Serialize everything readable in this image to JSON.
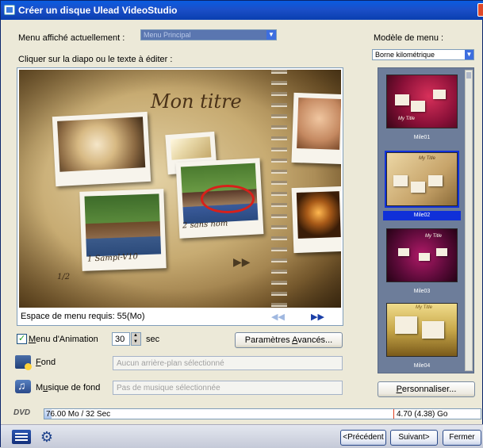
{
  "window": {
    "title": "Créer un disque Ulead VideoStudio"
  },
  "menu_current": {
    "label": "Menu affiché actuellement :",
    "value": "Menu Principal"
  },
  "instruction": "Cliquer sur la diapo ou le texte à éditer :",
  "template_menu": {
    "label": "Modèle de menu :",
    "value": "Borne kilométrique"
  },
  "preview": {
    "title": "Mon titre",
    "caption1": "1 Sampl-V10",
    "caption2": "2 sans nom",
    "page": "1/2",
    "required_space": "Espace de menu requis: 55(Mo)",
    "prev_icon": "double-chevron-left-icon",
    "next_icon": "double-chevron-right-icon"
  },
  "animation": {
    "label_pre": "",
    "label_key": "M",
    "label_post": "enu d'Animation",
    "checked": true,
    "value": "30",
    "unit": "sec"
  },
  "advanced_button": {
    "pre": "Paramètres ",
    "key": "A",
    "post": "vancés..."
  },
  "background": {
    "label_key": "F",
    "label_post": "ond",
    "placeholder": "Aucun arrière-plan sélectionné"
  },
  "music": {
    "label_pre": "M",
    "label_key": "u",
    "label_post": "sique de fond",
    "placeholder": "Pas de musique sélectionnée"
  },
  "templates": [
    {
      "name": "Mile01",
      "thumb_title": "My Title",
      "selected": false
    },
    {
      "name": "Mile02",
      "thumb_title": "My Title",
      "selected": true
    },
    {
      "name": "Mile03",
      "thumb_title": "My Title",
      "selected": false
    },
    {
      "name": "Mile04",
      "thumb_title": "My Title",
      "selected": false
    }
  ],
  "customize_button": {
    "key": "P",
    "post": "ersonnaliser..."
  },
  "dvd": {
    "logo": "DVD",
    "used": "76.00 Mo / 32 Sec",
    "capacity": "4.70 (4.38) Go",
    "used_fraction": 0.016
  },
  "footer": {
    "prev": "<Précédent",
    "next": "Suivant>",
    "close": "Fermer"
  }
}
